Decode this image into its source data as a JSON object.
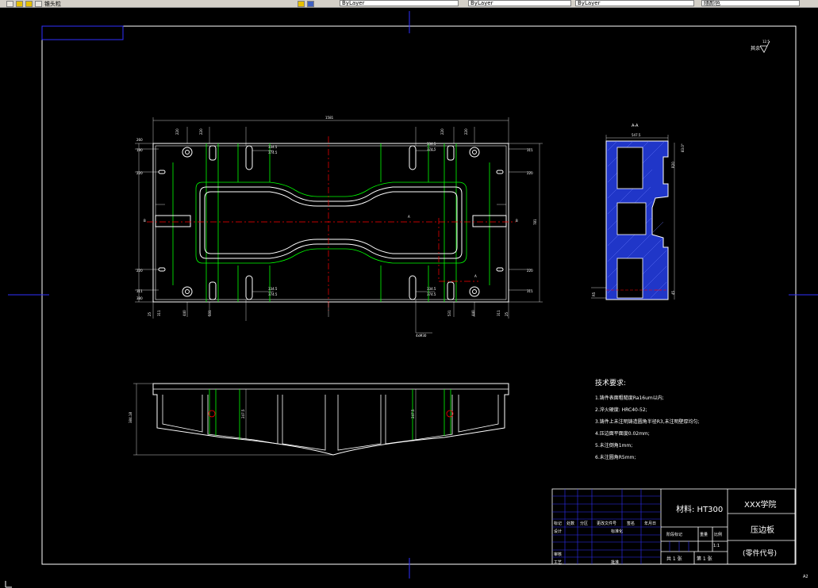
{
  "toolbar": {
    "left_field": "锥头粒",
    "fields": [
      "ByLayer",
      "ByLayer",
      "ByLayer",
      "随颜色"
    ]
  },
  "drawing": {
    "roughness": "其余",
    "roughness_value": "12.5",
    "section_label": "A-A",
    "sheet_size": "A2",
    "tech_title": "技术要求:",
    "tech_lines": [
      "1.铸件表面粗糙度Ra16um以内;",
      "2.淬火硬度:     HRC40-52;",
      "3.铸件上未注明铸造圆角半径R3,未注明壁厚均匀;",
      "4.压边面平面度0.02mm;",
      "5.未注倒角1mm;",
      "6.未注圆角R5mm;"
    ],
    "dims": {
      "overall_length": "1581",
      "overall_height": "781",
      "section_width": "547.5",
      "elevation_height": "384.18"
    }
  },
  "title_block": {
    "material": "材料: HT300",
    "school": "XXX学院",
    "part_name": "压边板",
    "part_code": "(零件代号)",
    "scale": "1:1",
    "sheets_total": "共 1 张",
    "sheet_num": "第 1 张",
    "headers": [
      "标记",
      "处数",
      "分区",
      "更改文件号",
      "签名",
      "年月日"
    ],
    "roles": [
      "设计",
      "标准化",
      "审核",
      "工艺",
      "批准"
    ],
    "stage_label": "阶段标记",
    "weight_label": "重量",
    "scale_label": "比例"
  },
  "colors": {
    "outline": "#ffffff",
    "green": "#00ff00",
    "red": "#ff0000",
    "blue": "#0000ff",
    "hatch": "#3040ff"
  }
}
